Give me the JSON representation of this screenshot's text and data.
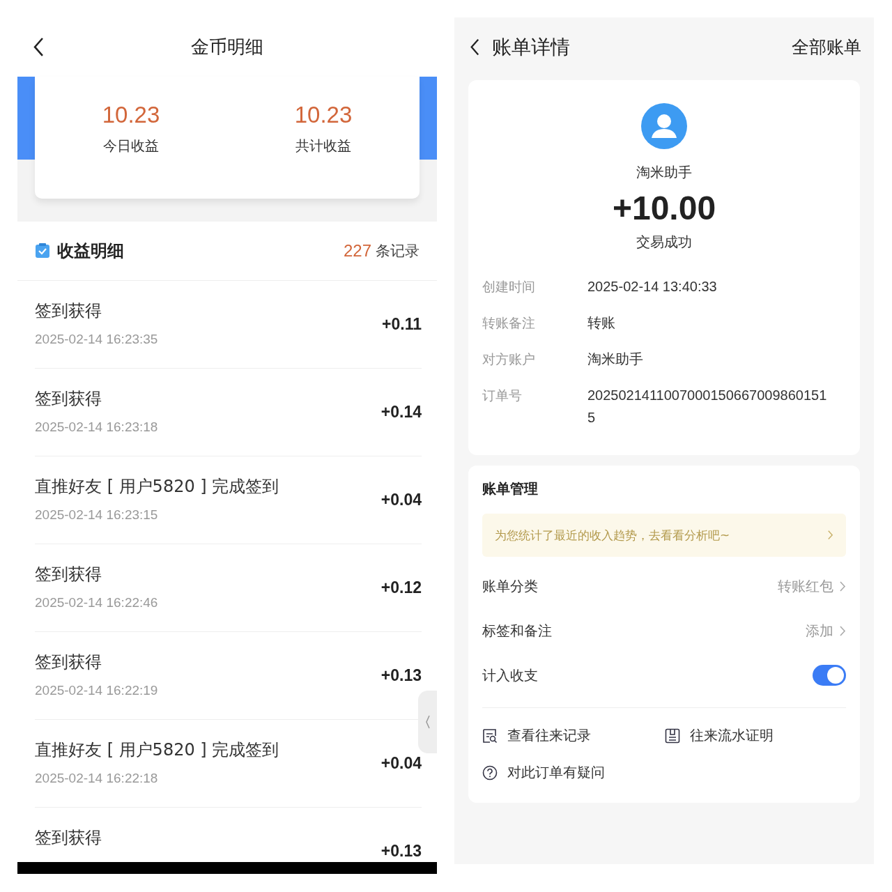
{
  "left": {
    "header": {
      "title": "金币明细"
    },
    "stats": [
      {
        "value": "10.23",
        "label": "今日收益"
      },
      {
        "value": "10.23",
        "label": "共计收益"
      }
    ],
    "list_header": {
      "title": "收益明细",
      "count": "227",
      "count_unit": "条记录"
    },
    "records": [
      {
        "title": "签到获得",
        "time": "2025-02-14 16:23:35",
        "amount": "+0.11"
      },
      {
        "title": "签到获得",
        "time": "2025-02-14 16:23:18",
        "amount": "+0.14"
      },
      {
        "title": "直推好友 [ 用户5820 ] 完成签到",
        "time": "2025-02-14 16:23:15",
        "amount": "+0.04"
      },
      {
        "title": "签到获得",
        "time": "2025-02-14 16:22:46",
        "amount": "+0.12"
      },
      {
        "title": "签到获得",
        "time": "2025-02-14 16:22:19",
        "amount": "+0.13"
      },
      {
        "title": "直推好友 [ 用户5820 ] 完成签到",
        "time": "2025-02-14 16:22:18",
        "amount": "+0.04"
      },
      {
        "title": "签到获得",
        "amount": "+0.13"
      }
    ]
  },
  "right": {
    "header": {
      "title": "账单详情",
      "action": "全部账单"
    },
    "summary": {
      "name": "淘米助手",
      "amount": "+10.00",
      "status": "交易成功"
    },
    "details": [
      {
        "label": "创建时间",
        "value": "2025-02-14 13:40:33"
      },
      {
        "label": "转账备注",
        "value": "转账"
      },
      {
        "label": "对方账户",
        "value": "淘米助手"
      },
      {
        "label": "订单号",
        "value": "20250214110070001506670098601515"
      }
    ],
    "management": {
      "title": "账单管理",
      "banner": "为您统计了最近的收入趋势，去看看分析吧~",
      "rows": [
        {
          "kind": "link",
          "label": "账单分类",
          "value": "转账红包"
        },
        {
          "kind": "link",
          "label": "标签和备注",
          "value": "添加"
        },
        {
          "kind": "toggle",
          "label": "计入收支",
          "on": true
        }
      ],
      "actions": [
        {
          "kind": "records",
          "label": "查看往来记录"
        },
        {
          "kind": "proof",
          "label": "往来流水证明"
        },
        {
          "kind": "question",
          "label": "对此订单有疑问"
        }
      ]
    }
  }
}
